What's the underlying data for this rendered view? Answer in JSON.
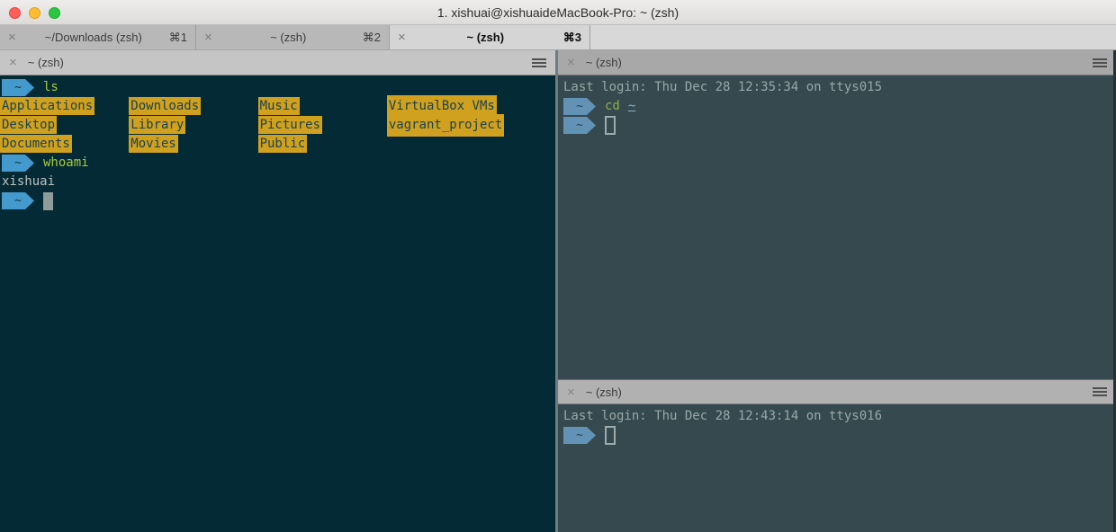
{
  "window": {
    "title": "1. xishuai@xishuaideMacBook-Pro: ~ (zsh)"
  },
  "tabs": [
    {
      "label": "~/Downloads (zsh)",
      "shortcut": "⌘1",
      "close": "×",
      "active": false
    },
    {
      "label": "~ (zsh)",
      "shortcut": "⌘2",
      "close": "×",
      "active": false
    },
    {
      "label": "~ (zsh)",
      "shortcut": "⌘3",
      "close": "×",
      "active": true
    }
  ],
  "panes": {
    "left": {
      "title": "~ (zsh)",
      "close": "×",
      "prompt": "~",
      "command_ls": "ls",
      "ls_rows": [
        [
          "Applications",
          "Downloads",
          "Music",
          "VirtualBox VMs"
        ],
        [
          "Desktop",
          "Library",
          "Pictures",
          "vagrant_project"
        ],
        [
          "Documents",
          "Movies",
          "Public"
        ]
      ],
      "command_whoami": "whoami",
      "whoami_output": "xishuai"
    },
    "right_top": {
      "title": "~ (zsh)",
      "close": "×",
      "prompt": "~",
      "last_login": "Last login: Thu Dec 28 12:35:34 on ttys015",
      "command": "cd",
      "command_arg": "~"
    },
    "right_bottom": {
      "title": "~ (zsh)",
      "close": "×",
      "prompt": "~",
      "last_login": "Last login: Thu Dec 28 12:43:14 on ttys016"
    }
  },
  "colors": {
    "left_terminal_bg": "#042b35",
    "right_terminal_bg": "#35494f",
    "ls_highlight": "#d0a01f",
    "prompt_arrow_active": "#4499cd",
    "prompt_arrow_dim": "#6292b4",
    "command_green": "#a4c93c",
    "divider_gray": "#6e7c82",
    "traffic_red": "#ff5f57",
    "traffic_yellow": "#febc2e",
    "traffic_green": "#28c840"
  }
}
